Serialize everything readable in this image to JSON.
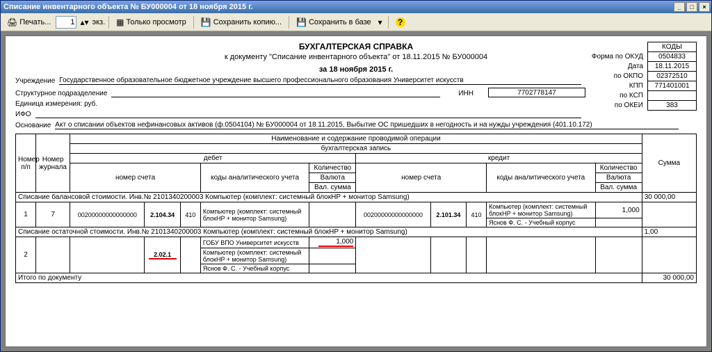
{
  "window_title": "Списание инвентарного объекта № БУ000004 от 18 ноября 2015 г.",
  "toolbar": {
    "print": "Печать...",
    "copies_value": "1",
    "copies_suffix": "экз.",
    "view_only": "Только просмотр",
    "save_copy": "Сохранить копию...",
    "save_db": "Сохранить в базе"
  },
  "header": {
    "title": "БУХГАЛТЕРСКАЯ СПРАВКА",
    "subtitle": "к документу \"Списание инвентарного объекта\" от 18.11.2015 № БУ000004",
    "date_line": "за 18 ноября 2015 г.",
    "org_label": "Учреждение",
    "org_value": "Государственное образовательное бюджетное учреждение высшего профессионального образования  Университет искусств",
    "struct_label": "Структурное подразделение",
    "unit_label": "Единица измерения: руб.",
    "ifo_label": "ИФО",
    "basis_label": "Основание",
    "basis_value": "Акт о списании объектов нефинансовых активов (ф.0504104) № БУ000004 от 18.11.2015, Выбытие ОС пришедших в негодность и на нужды учреждения (401.10.172)",
    "inn_label": "ИНН",
    "inn_value": "7702778147"
  },
  "codes": {
    "okud_lbl": "Форма  по ОКУД",
    "okud": "0504833",
    "date_lbl": "Дата",
    "date": "18.11.2015",
    "okpo_lbl": "по ОКПО",
    "okpo": "02372510",
    "kpp_lbl": "КПП",
    "kpp": "771401001",
    "ksp_lbl": "по КСП",
    "ksp": "",
    "okei_lbl": "по ОКЕИ",
    "okei": "383",
    "codes_hdr": "КОДЫ"
  },
  "grid_header": {
    "np": "Номер п/п",
    "journal": "Номер журнала",
    "op_name": "Наименование и содержание проводимой операции",
    "buh": "бухгалтерская запись",
    "debit": "дебет",
    "credit": "кредит",
    "acct": "номер счета",
    "anal": "коды аналитического учета",
    "qty": "Количество",
    "cur": "Валюта",
    "val": "Вал. сумма",
    "sum": "Сумма"
  },
  "section1": "Списание балансовой стоимости. Инв.№ 2101340200003 Компьютер (комплект: системный блокHP + монитор Samsung)",
  "section1_sum": "30 000,00",
  "row1": {
    "np": "1",
    "journal": "7",
    "deb_acct": "00200000000000000",
    "deb_acct2": "2.104.34",
    "deb_acct3": "410",
    "deb_anal_items": "Компьютер (комплект: системный блокHP + монитор Samsung)",
    "cred_acct": "00200000000000000",
    "cred_acct2": "2.101.34",
    "cred_acct3": "410",
    "cred_anal_top": "Компьютер (комплект: системный блокHP + монитор Samsung)",
    "cred_anal_bot": "Яснов Ф. С. - Учебный корпус",
    "qty": "1,000"
  },
  "section2": "Списание остаточной стоимости. Инв.№ 2101340200003 Компьютер (комплект: системный блокHP + монитор Samsung)",
  "section2_sum": "1,00",
  "row2": {
    "np": "2",
    "cred_acct2": "2.02.1",
    "cred_anal1": "ГОБУ ВПО Университет искусств",
    "cred_qty": "1,000",
    "cred_anal2": "Компьютер (комплект: системный блокHP + монитор Samsung)",
    "cred_anal3": "Яснов Ф. С. - Учебный корпус"
  },
  "totals_label": "Итого по документу",
  "totals_sum": "30 000,00"
}
